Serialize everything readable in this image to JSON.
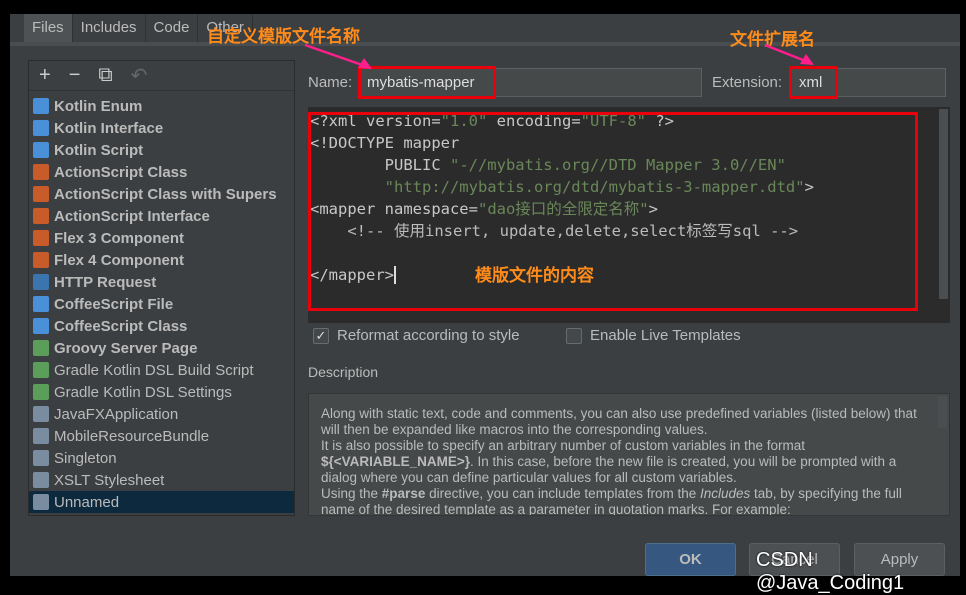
{
  "tabs": [
    "Files",
    "Includes",
    "Code",
    "Other"
  ],
  "toolbar": {
    "add": "+",
    "remove": "−",
    "copy": "⧉",
    "reset": "↶"
  },
  "templates": [
    {
      "label": "Kotlin Enum",
      "bold": true,
      "icon": "kotlin-icon",
      "color": "#4a90d9"
    },
    {
      "label": "Kotlin Interface",
      "bold": true,
      "icon": "kotlin-icon",
      "color": "#4a90d9"
    },
    {
      "label": "Kotlin Script",
      "bold": true,
      "icon": "kotlin-icon",
      "color": "#4a90d9"
    },
    {
      "label": "ActionScript Class",
      "bold": true,
      "icon": "actionscript-icon",
      "color": "#c75b2a"
    },
    {
      "label": "ActionScript Class with Supers",
      "bold": true,
      "icon": "actionscript-icon",
      "color": "#c75b2a"
    },
    {
      "label": "ActionScript Interface",
      "bold": true,
      "icon": "actionscript-icon",
      "color": "#c75b2a"
    },
    {
      "label": "Flex 3 Component",
      "bold": true,
      "icon": "flex-icon",
      "color": "#c75b2a"
    },
    {
      "label": "Flex 4 Component",
      "bold": true,
      "icon": "flex-icon",
      "color": "#c75b2a"
    },
    {
      "label": "HTTP Request",
      "bold": true,
      "icon": "api-icon",
      "color": "#3a75b0"
    },
    {
      "label": "CoffeeScript File",
      "bold": true,
      "icon": "coffeescript-icon",
      "color": "#4a90d9"
    },
    {
      "label": "CoffeeScript Class",
      "bold": true,
      "icon": "coffeescript-icon",
      "color": "#4a90d9"
    },
    {
      "label": "Groovy Server Page",
      "bold": true,
      "icon": "groovy-icon",
      "color": "#5a9e5a"
    },
    {
      "label": "Gradle Kotlin DSL Build Script",
      "bold": false,
      "icon": "gradle-icon",
      "color": "#5a9e5a"
    },
    {
      "label": "Gradle Kotlin DSL Settings",
      "bold": false,
      "icon": "gradle-icon",
      "color": "#5a9e5a"
    },
    {
      "label": "JavaFXApplication",
      "bold": false,
      "icon": "java-file-icon",
      "color": "#7a8da0"
    },
    {
      "label": "MobileResourceBundle",
      "bold": false,
      "icon": "java-file-icon",
      "color": "#7a8da0"
    },
    {
      "label": "Singleton",
      "bold": false,
      "icon": "java-file-icon",
      "color": "#7a8da0"
    },
    {
      "label": "XSLT Stylesheet",
      "bold": false,
      "icon": "java-file-icon",
      "color": "#7a8da0"
    },
    {
      "label": "Unnamed",
      "bold": false,
      "icon": "java-file-icon",
      "color": "#7a8da0",
      "selected": true
    }
  ],
  "name_label": "Name:",
  "name_value": "mybatis-mapper",
  "extension_label": "Extension:",
  "extension_value": "xml",
  "annotations": {
    "name": "自定义模版文件名称",
    "extension": "文件扩展名",
    "content": "模版文件的内容"
  },
  "code": {
    "l1a": "<?xml version=",
    "l1b": "\"1.0\"",
    "l1c": " encoding=",
    "l1d": "\"UTF-8\"",
    "l1e": " ?>",
    "l2": "<!DOCTYPE mapper",
    "l3a": "        PUBLIC ",
    "l3b": "\"-//mybatis.org//DTD Mapper 3.0//EN\"",
    "l4a": "        ",
    "l4b": "\"http://mybatis.org/dtd/mybatis-3-mapper.dtd\"",
    "l4c": ">",
    "l5a": "<mapper namespace=",
    "l5b": "\"dao接口的全限定名称\"",
    "l5c": ">",
    "l6": "    <!-- 使用insert, update,delete,select标签写sql -->",
    "l7": "",
    "l8": "</mapper>"
  },
  "reformat": {
    "label": "Reformat according to style",
    "checked": true
  },
  "live_templates": {
    "label": "Enable Live Templates",
    "checked": false
  },
  "description_label": "Description",
  "description": {
    "p1": "Along with static text, code and comments, you can also use predefined variables (listed below) that will then be expanded like macros into the corresponding values.",
    "p2a": "It is also possible to specify an arbitrary number of custom variables in the format ",
    "p2b": "${<VARIABLE_NAME>}",
    "p2c": ". In this case, before the new file is created, you will be prompted with a dialog where you can define particular values for all custom variables.",
    "p3a": "Using the ",
    "p3b": "#parse",
    "p3c": " directive, you can include templates from the ",
    "p3d": "Includes",
    "p3e": " tab, by specifying the full name of the desired template as a parameter in quotation marks. For example:"
  },
  "buttons": {
    "ok": "OK",
    "cancel": "Cancel",
    "apply": "Apply"
  },
  "watermark": "CSDN @Java_Coding1"
}
